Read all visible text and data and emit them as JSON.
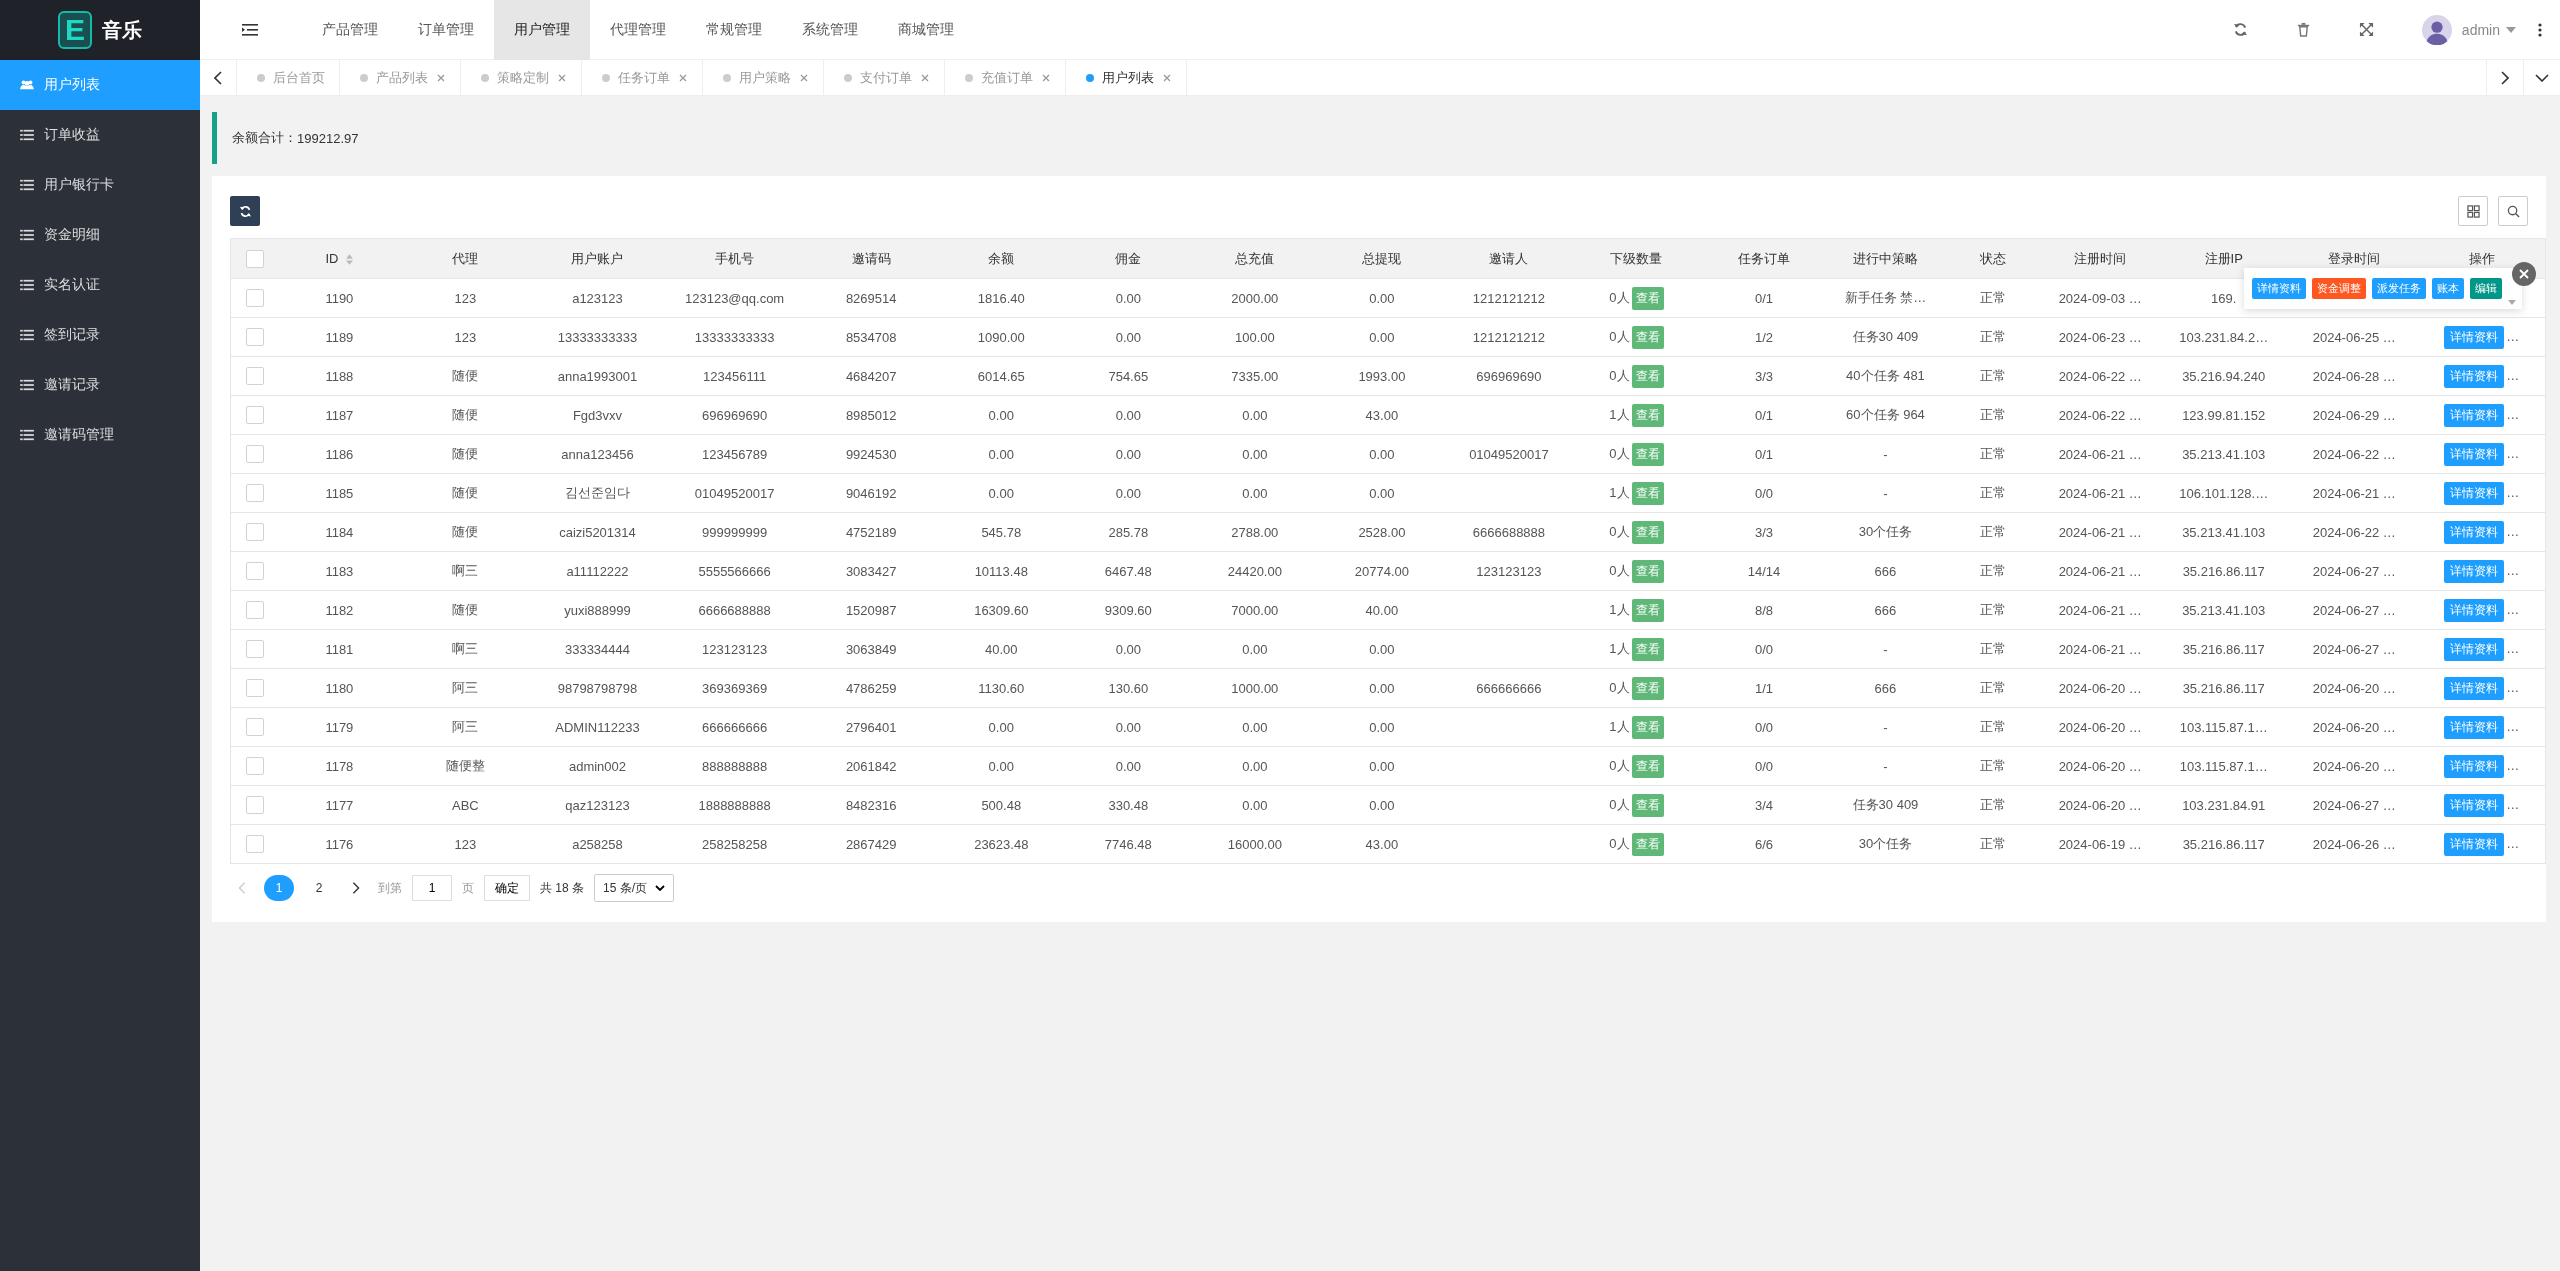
{
  "brand": {
    "logo_letter": "E",
    "name": "音乐"
  },
  "sidebar": {
    "items": [
      {
        "label": "用户列表",
        "kind": "users",
        "selected": true
      },
      {
        "label": "订单收益",
        "kind": "list",
        "selected": false
      },
      {
        "label": "用户银行卡",
        "kind": "list",
        "selected": false
      },
      {
        "label": "资金明细",
        "kind": "list",
        "selected": false
      },
      {
        "label": "实名认证",
        "kind": "list",
        "selected": false
      },
      {
        "label": "签到记录",
        "kind": "list",
        "selected": false
      },
      {
        "label": "邀请记录",
        "kind": "list",
        "selected": false
      },
      {
        "label": "邀请码管理",
        "kind": "list",
        "selected": false
      }
    ]
  },
  "top_nav": {
    "items": [
      {
        "label": "产品管理",
        "selected": false
      },
      {
        "label": "订单管理",
        "selected": false
      },
      {
        "label": "用户管理",
        "selected": true
      },
      {
        "label": "代理管理",
        "selected": false
      },
      {
        "label": "常规管理",
        "selected": false
      },
      {
        "label": "系统管理",
        "selected": false
      },
      {
        "label": "商城管理",
        "selected": false
      }
    ],
    "user": "admin"
  },
  "tabs": [
    {
      "label": "后台首页",
      "closable": false,
      "selected": false
    },
    {
      "label": "产品列表",
      "closable": true,
      "selected": false
    },
    {
      "label": "策略定制",
      "closable": true,
      "selected": false
    },
    {
      "label": "任务订单",
      "closable": true,
      "selected": false
    },
    {
      "label": "用户策略",
      "closable": true,
      "selected": false
    },
    {
      "label": "支付订单",
      "closable": true,
      "selected": false
    },
    {
      "label": "充值订单",
      "closable": true,
      "selected": false
    },
    {
      "label": "用户列表",
      "closable": true,
      "selected": true
    }
  ],
  "notice": {
    "label": "余额合计：",
    "value": "199212.97"
  },
  "table": {
    "all_checked": false,
    "columns": [
      {
        "label": "ID",
        "sortable": true
      },
      {
        "label": "代理"
      },
      {
        "label": "用户账户"
      },
      {
        "label": "手机号"
      },
      {
        "label": "邀请码"
      },
      {
        "label": "余额"
      },
      {
        "label": "佣金"
      },
      {
        "label": "总充值"
      },
      {
        "label": "总提现"
      },
      {
        "label": "邀请人"
      },
      {
        "label": "下级数量"
      },
      {
        "label": "任务订单"
      },
      {
        "label": "进行中策略"
      },
      {
        "label": "状态"
      },
      {
        "label": "注册时间"
      },
      {
        "label": "注册IP"
      },
      {
        "label": "登录时间"
      },
      {
        "label": "操作"
      }
    ],
    "rows": [
      {
        "checked": false,
        "cells": [
          "1190",
          "123",
          "a123123",
          "123123@qq.com",
          "8269514",
          "1816.40",
          "0.00",
          "2000.00",
          "0.00",
          "1212121212"
        ],
        "subs": "0人",
        "view": "查看",
        "cells2": [
          "0/1",
          "新手任务 禁…",
          "正常",
          "2024-09-03 …",
          "169."
        ]
      },
      {
        "checked": false,
        "cells": [
          "1189",
          "123",
          "13333333333",
          "13333333333",
          "8534708",
          "1090.00",
          "0.00",
          "100.00",
          "0.00",
          "1212121212"
        ],
        "subs": "0人",
        "view": "查看",
        "cells2": [
          "1/2",
          "任务30 409",
          "正常",
          "2024-06-23 …",
          "103.231.84.2…",
          "2024-06-25 …"
        ],
        "action": "详情资料",
        "more": "…"
      },
      {
        "checked": false,
        "cells": [
          "1188",
          "随便",
          "anna1993001",
          "123456111",
          "4684207",
          "6014.65",
          "754.65",
          "7335.00",
          "1993.00",
          "696969690"
        ],
        "subs": "0人",
        "view": "查看",
        "cells2": [
          "3/3",
          "40个任务 481",
          "正常",
          "2024-06-22 …",
          "35.216.94.240",
          "2024-06-28 …"
        ],
        "action": "详情资料",
        "more": "…"
      },
      {
        "checked": false,
        "cells": [
          "1187",
          "随便",
          "Fgd3vxv",
          "696969690",
          "8985012",
          "0.00",
          "0.00",
          "0.00",
          "43.00",
          ""
        ],
        "subs": "1人",
        "view": "查看",
        "cells2": [
          "0/1",
          "60个任务 964",
          "正常",
          "2024-06-22 …",
          "123.99.81.152",
          "2024-06-29 …"
        ],
        "action": "详情资料",
        "more": "…"
      },
      {
        "checked": false,
        "cells": [
          "1186",
          "随便",
          "anna123456",
          "123456789",
          "9924530",
          "0.00",
          "0.00",
          "0.00",
          "0.00",
          "01049520017"
        ],
        "subs": "0人",
        "view": "查看",
        "cells2": [
          "0/1",
          "-",
          "正常",
          "2024-06-21 …",
          "35.213.41.103",
          "2024-06-22 …"
        ],
        "action": "详情资料",
        "more": "…"
      },
      {
        "checked": false,
        "cells": [
          "1185",
          "随便",
          "김선준임다",
          "01049520017",
          "9046192",
          "0.00",
          "0.00",
          "0.00",
          "0.00",
          ""
        ],
        "subs": "1人",
        "view": "查看",
        "cells2": [
          "0/0",
          "-",
          "正常",
          "2024-06-21 …",
          "106.101.128.…",
          "2024-06-21 …"
        ],
        "action": "详情资料",
        "more": "…"
      },
      {
        "checked": false,
        "cells": [
          "1184",
          "随便",
          "caizi5201314",
          "999999999",
          "4752189",
          "545.78",
          "285.78",
          "2788.00",
          "2528.00",
          "6666688888"
        ],
        "subs": "0人",
        "view": "查看",
        "cells2": [
          "3/3",
          "30个任务",
          "正常",
          "2024-06-21 …",
          "35.213.41.103",
          "2024-06-22 …"
        ],
        "action": "详情资料",
        "more": "…"
      },
      {
        "checked": false,
        "cells": [
          "1183",
          "啊三",
          "a11112222",
          "5555566666",
          "3083427",
          "10113.48",
          "6467.48",
          "24420.00",
          "20774.00",
          "123123123"
        ],
        "subs": "0人",
        "view": "查看",
        "cells2": [
          "14/14",
          "666",
          "正常",
          "2024-06-21 …",
          "35.216.86.117",
          "2024-06-27 …"
        ],
        "action": "详情资料",
        "more": "…"
      },
      {
        "checked": false,
        "cells": [
          "1182",
          "随便",
          "yuxi888999",
          "6666688888",
          "1520987",
          "16309.60",
          "9309.60",
          "7000.00",
          "40.00",
          ""
        ],
        "subs": "1人",
        "view": "查看",
        "cells2": [
          "8/8",
          "666",
          "正常",
          "2024-06-21 …",
          "35.213.41.103",
          "2024-06-27 …"
        ],
        "action": "详情资料",
        "more": "…"
      },
      {
        "checked": false,
        "cells": [
          "1181",
          "啊三",
          "333334444",
          "123123123",
          "3063849",
          "40.00",
          "0.00",
          "0.00",
          "0.00",
          ""
        ],
        "subs": "1人",
        "view": "查看",
        "cells2": [
          "0/0",
          "-",
          "正常",
          "2024-06-21 …",
          "35.216.86.117",
          "2024-06-27 …"
        ],
        "action": "详情资料",
        "more": "…"
      },
      {
        "checked": false,
        "cells": [
          "1180",
          "阿三",
          "98798798798",
          "369369369",
          "4786259",
          "1130.60",
          "130.60",
          "1000.00",
          "0.00",
          "666666666"
        ],
        "subs": "0人",
        "view": "查看",
        "cells2": [
          "1/1",
          "666",
          "正常",
          "2024-06-20 …",
          "35.216.86.117",
          "2024-06-20 …"
        ],
        "action": "详情资料",
        "more": "…"
      },
      {
        "checked": false,
        "cells": [
          "1179",
          "阿三",
          "ADMIN112233",
          "666666666",
          "2796401",
          "0.00",
          "0.00",
          "0.00",
          "0.00",
          ""
        ],
        "subs": "1人",
        "view": "查看",
        "cells2": [
          "0/0",
          "-",
          "正常",
          "2024-06-20 …",
          "103.115.87.1…",
          "2024-06-20 …"
        ],
        "action": "详情资料",
        "more": "…"
      },
      {
        "checked": false,
        "cells": [
          "1178",
          "随便整",
          "admin002",
          "888888888",
          "2061842",
          "0.00",
          "0.00",
          "0.00",
          "0.00",
          ""
        ],
        "subs": "0人",
        "view": "查看",
        "cells2": [
          "0/0",
          "-",
          "正常",
          "2024-06-20 …",
          "103.115.87.1…",
          "2024-06-20 …"
        ],
        "action": "详情资料",
        "more": "…"
      },
      {
        "checked": false,
        "cells": [
          "1177",
          "ABC",
          "qaz123123",
          "1888888888",
          "8482316",
          "500.48",
          "330.48",
          "0.00",
          "0.00",
          ""
        ],
        "subs": "0人",
        "view": "查看",
        "cells2": [
          "3/4",
          "任务30 409",
          "正常",
          "2024-06-20 …",
          "103.231.84.91",
          "2024-06-27 …"
        ],
        "action": "详情资料",
        "more": "…"
      },
      {
        "checked": false,
        "cells": [
          "1176",
          "123",
          "a258258",
          "258258258",
          "2867429",
          "23623.48",
          "7746.48",
          "16000.00",
          "43.00",
          ""
        ],
        "subs": "0人",
        "view": "查看",
        "cells2": [
          "6/6",
          "30个任务",
          "正常",
          "2024-06-19 …",
          "35.216.86.117",
          "2024-06-26 …"
        ],
        "action": "详情资料",
        "more": "…"
      }
    ]
  },
  "row_popup": {
    "buttons": [
      {
        "label": "详情资料",
        "color": "#1e9fff"
      },
      {
        "label": "资金调整",
        "color": "#ff5722"
      },
      {
        "label": "派发任务",
        "color": "#1e9fff"
      },
      {
        "label": "账本",
        "color": "#1e9fff"
      },
      {
        "label": "编辑",
        "color": "#009688"
      }
    ]
  },
  "pagination": {
    "pages": [
      {
        "label": "1",
        "selected": true
      },
      {
        "label": "2",
        "selected": false
      }
    ],
    "goto_label": "到第",
    "goto_value": "1",
    "page_label": "页",
    "confirm": "确定",
    "total": "共 18 条",
    "page_size": "15 条/页"
  }
}
